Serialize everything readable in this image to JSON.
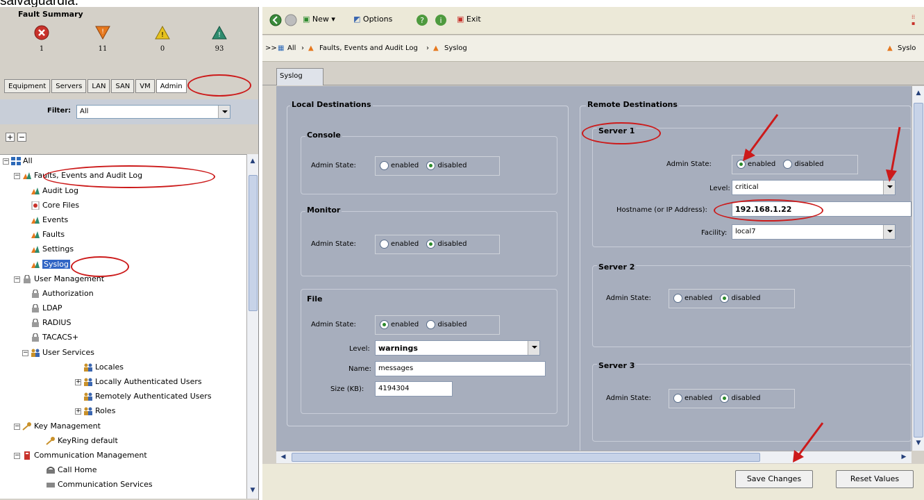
{
  "caption": "salvaguardia.",
  "fault_summary": {
    "title": "Fault Summary",
    "items": [
      {
        "severity": "critical",
        "count": "1",
        "icon": "critical-x-icon",
        "color": "#c8322b"
      },
      {
        "severity": "major",
        "count": "11",
        "icon": "major-triangle-icon",
        "color": "#e6781e"
      },
      {
        "severity": "minor",
        "count": "0",
        "icon": "minor-triangle-icon",
        "color": "#e6c21e"
      },
      {
        "severity": "warning",
        "count": "93",
        "icon": "warning-triangle-icon",
        "color": "#2e8b6e"
      }
    ]
  },
  "nav_tabs": [
    "Equipment",
    "Servers",
    "LAN",
    "SAN",
    "VM",
    "Admin"
  ],
  "filter": {
    "label": "Filter:",
    "value": "All"
  },
  "tree": {
    "root": "All",
    "items": [
      {
        "label": "Faults, Events and Audit Log",
        "level": 1
      },
      {
        "label": "Audit Log",
        "level": 2
      },
      {
        "label": "Core Files",
        "level": 2
      },
      {
        "label": "Events",
        "level": 2
      },
      {
        "label": "Faults",
        "level": 2
      },
      {
        "label": "Settings",
        "level": 2
      },
      {
        "label": "Syslog",
        "level": 2
      },
      {
        "label": "User Management",
        "level": 1
      },
      {
        "label": "Authorization",
        "level": 2
      },
      {
        "label": "LDAP",
        "level": 2
      },
      {
        "label": "RADIUS",
        "level": 2
      },
      {
        "label": "TACACS+",
        "level": 2
      },
      {
        "label": "User Services",
        "level": 2
      },
      {
        "label": "Locales",
        "level": 3
      },
      {
        "label": "Locally Authenticated Users",
        "level": 3
      },
      {
        "label": "Remotely Authenticated Users",
        "level": 3
      },
      {
        "label": "Roles",
        "level": 3
      },
      {
        "label": "Key Management",
        "level": 1
      },
      {
        "label": "KeyRing default",
        "level": 2
      },
      {
        "label": "Communication Management",
        "level": 1
      },
      {
        "label": "Call Home",
        "level": 2
      },
      {
        "label": "Communication Services",
        "level": 2
      }
    ]
  },
  "toolbar": {
    "new": "New",
    "options": "Options",
    "exit": "Exit"
  },
  "breadcrumb": {
    "prefix": ">>",
    "items": [
      "All",
      "Faults, Events and Audit Log",
      "Syslog"
    ],
    "right": "Syslo"
  },
  "subtab": "Syslog",
  "local": {
    "title": "Local Destinations",
    "console": {
      "title": "Console",
      "label": "Admin State:",
      "enabled": "enabled",
      "disabled": "disabled",
      "state": "disabled"
    },
    "monitor": {
      "title": "Monitor",
      "label": "Admin State:",
      "enabled": "enabled",
      "disabled": "disabled",
      "state": "disabled"
    },
    "file": {
      "title": "File",
      "label": "Admin State:",
      "enabled": "enabled",
      "disabled": "disabled",
      "state": "enabled",
      "level_label": "Level:",
      "level": "warnings",
      "name_label": "Name:",
      "name": "messages",
      "size_label": "Size (KB):",
      "size": "4194304"
    }
  },
  "remote": {
    "title": "Remote Destinations",
    "server1": {
      "title": "Server 1",
      "label": "Admin State:",
      "enabled": "enabled",
      "disabled": "disabled",
      "state": "enabled",
      "level_label": "Level:",
      "level": "critical",
      "host_label": "Hostname (or IP Address):",
      "host": "192.168.1.22",
      "facility_label": "Facility:",
      "facility": "local7"
    },
    "server2": {
      "title": "Server 2",
      "label": "Admin State:",
      "enabled": "enabled",
      "disabled": "disabled",
      "state": "disabled"
    },
    "server3": {
      "title": "Server 3",
      "label": "Admin State:",
      "enabled": "enabled",
      "disabled": "disabled",
      "state": "disabled"
    }
  },
  "footer": {
    "save": "Save Changes",
    "reset": "Reset Values"
  }
}
